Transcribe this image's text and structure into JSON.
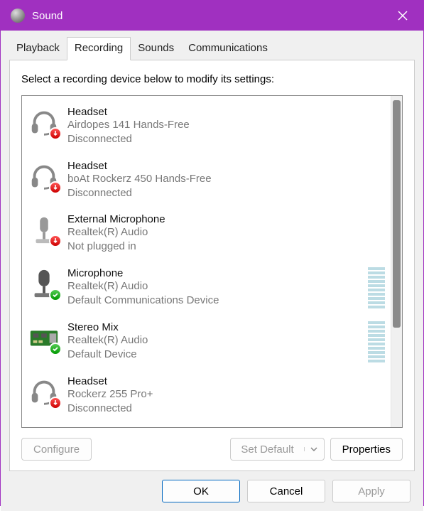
{
  "window": {
    "title": "Sound"
  },
  "tabs": [
    {
      "label": "Playback",
      "active": false
    },
    {
      "label": "Recording",
      "active": true
    },
    {
      "label": "Sounds",
      "active": false
    },
    {
      "label": "Communications",
      "active": false
    }
  ],
  "instruction": "Select a recording device below to modify its settings:",
  "devices": [
    {
      "name": "Headset",
      "desc": "Airdopes 141 Hands-Free",
      "status": "Disconnected",
      "icon": "headset",
      "badge": "disconnected",
      "meter": false
    },
    {
      "name": "Headset",
      "desc": "boAt Rockerz 450 Hands-Free",
      "status": "Disconnected",
      "icon": "headset",
      "badge": "disconnected",
      "meter": false
    },
    {
      "name": "External Microphone",
      "desc": "Realtek(R) Audio",
      "status": "Not plugged in",
      "icon": "mic-ext",
      "badge": "disconnected",
      "meter": false
    },
    {
      "name": "Microphone",
      "desc": "Realtek(R) Audio",
      "status": "Default Communications Device",
      "icon": "mic",
      "badge": "default",
      "meter": true
    },
    {
      "name": "Stereo Mix",
      "desc": "Realtek(R) Audio",
      "status": "Default Device",
      "icon": "board",
      "badge": "default",
      "meter": true
    },
    {
      "name": "Headset",
      "desc": "Rockerz 255 Pro+",
      "status": "Disconnected",
      "icon": "headset",
      "badge": "disconnected",
      "meter": false
    }
  ],
  "buttons": {
    "configure": "Configure",
    "setdefault": "Set Default",
    "properties": "Properties",
    "ok": "OK",
    "cancel": "Cancel",
    "apply": "Apply"
  }
}
